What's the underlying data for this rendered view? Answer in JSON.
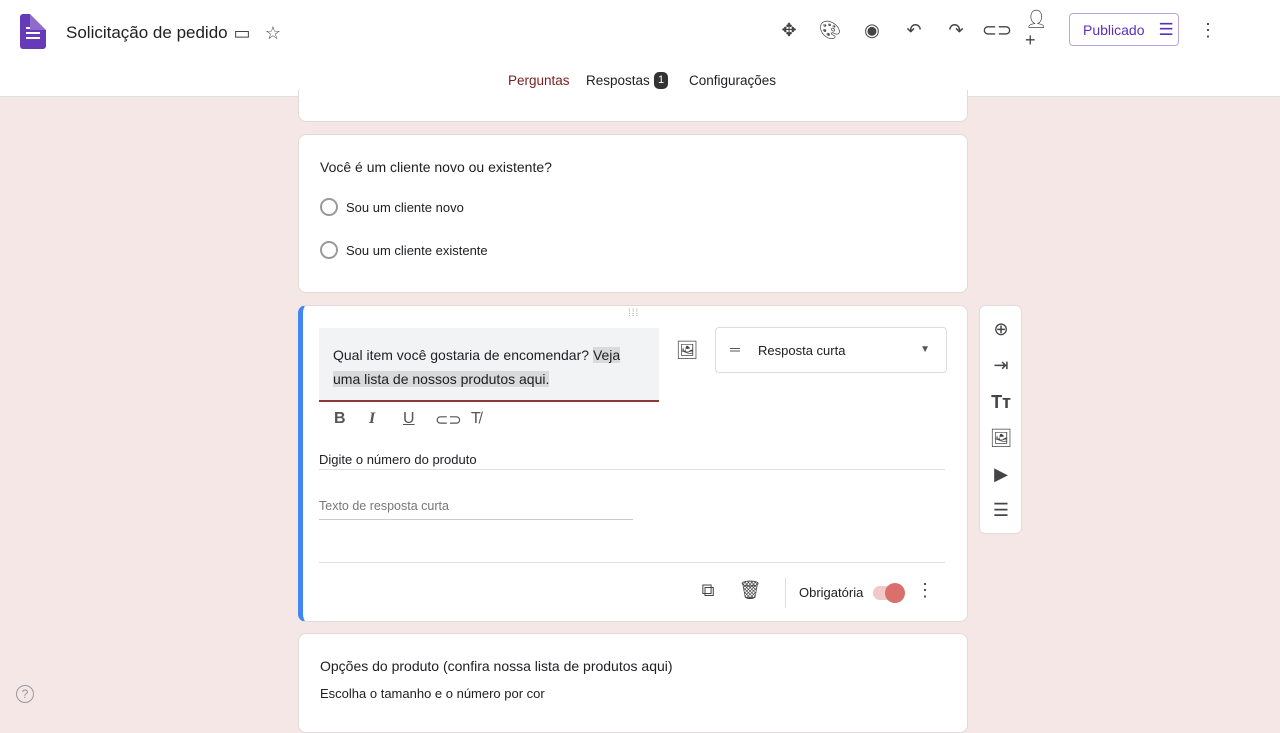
{
  "header": {
    "title": "Solicitação de pedido",
    "publish_label": "Publicado"
  },
  "tabs": [
    {
      "label": "Perguntas"
    },
    {
      "label": "Respostas",
      "badge": "1"
    },
    {
      "label": "Configurações"
    }
  ],
  "questions": [
    {
      "title": "Você é um cliente novo ou existente?",
      "options": [
        "Sou um cliente novo",
        "Sou um cliente existente"
      ]
    },
    {
      "title_plain": "Qual item você gostaria de encomendar? ",
      "title_highlight_1": "Veja",
      "title_highlight_2": "uma lista de nossos produtos aqui.",
      "type": "Resposta curta",
      "description": "Digite o número do produto",
      "placeholder": "Texto de resposta curta",
      "required_label": "Obrigatória",
      "required": true
    },
    {
      "title": "Opções do produto (confira nossa lista de produtos aqui)",
      "description": "Escolha o tamanho e o número por cor"
    }
  ],
  "colors": {
    "accent": "#7b2020",
    "selected_border": "#4285f4",
    "background": "#f6e7e7",
    "toggle": "#d9706c"
  }
}
